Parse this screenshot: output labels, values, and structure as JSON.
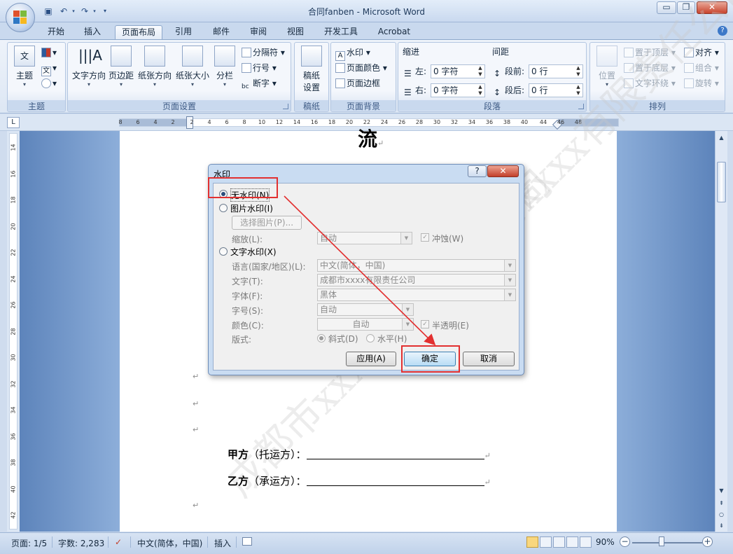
{
  "window": {
    "title": "合同fanben - Microsoft Word",
    "minimize": "▭",
    "restore": "❐",
    "close": "✕"
  },
  "quick_access": [
    "save-icon",
    "undo-icon",
    "redo-icon",
    "customize-icon"
  ],
  "tabs": [
    {
      "label": "开始"
    },
    {
      "label": "插入"
    },
    {
      "label": "页面布局",
      "active": true
    },
    {
      "label": "引用"
    },
    {
      "label": "邮件"
    },
    {
      "label": "审阅"
    },
    {
      "label": "视图"
    },
    {
      "label": "开发工具"
    },
    {
      "label": "Acrobat"
    }
  ],
  "ribbon": {
    "theme_group": {
      "label": "主题",
      "button": "主题"
    },
    "page_setup": {
      "label": "页面设置",
      "text_direction": "文字方向",
      "margins": "页边距",
      "orientation": "纸张方向",
      "size": "纸张大小",
      "columns": "分栏",
      "breaks": "分隔符",
      "line_numbers": "行号",
      "hyphenation": "断字"
    },
    "draft": {
      "label": "稿纸",
      "button_line1": "稿纸",
      "button_line2": "设置"
    },
    "page_background": {
      "label": "页面背景",
      "watermark": "水印",
      "page_color": "页面颜色",
      "page_borders": "页面边框"
    },
    "paragraph": {
      "label": "段落",
      "indent_title": "缩进",
      "spacing_title": "间距",
      "left_label": "左:",
      "left_value": "0 字符",
      "right_label": "右:",
      "right_value": "0 字符",
      "before_label": "段前:",
      "before_value": "0 行",
      "after_label": "段后:",
      "after_value": "0 行"
    },
    "arrange": {
      "label": "排列",
      "position": "位置",
      "bring_front": "置于顶层",
      "send_back": "置于底层",
      "text_wrap": "文字环绕",
      "align": "对齐",
      "group": "组合",
      "rotate": "旋转"
    }
  },
  "ruler": {
    "ticks": [
      "8",
      "6",
      "4",
      "2",
      "2",
      "4",
      "6",
      "8",
      "10",
      "12",
      "14",
      "16",
      "18",
      "20",
      "22",
      "24",
      "26",
      "28",
      "30",
      "32",
      "34",
      "36",
      "38",
      "40",
      "44",
      "46",
      "48"
    ],
    "vticks": [
      "14",
      "16",
      "18",
      "20",
      "22",
      "24",
      "26",
      "28",
      "30",
      "32",
      "34",
      "36",
      "38",
      "40",
      "42"
    ]
  },
  "document": {
    "heading_fragment": "流",
    "party_a_bold": "甲方",
    "party_a_rest": "（托运方）：",
    "party_b_bold": "乙方",
    "party_b_rest": "（承运方）：",
    "watermark_text": "成都市xxxx有限责任公司"
  },
  "dialog": {
    "title": "水印",
    "help": "?",
    "close": "✕",
    "no_watermark": "无水印(N)",
    "picture_watermark": "图片水印(I)",
    "select_picture": "选择图片(P)...",
    "scale_label": "缩放(L):",
    "scale_value": "自动",
    "washout": "冲蚀(W)",
    "text_watermark": "文字水印(X)",
    "language_label": "语言(国家/地区)(L):",
    "language_value": "中文(简体，中国)",
    "text_label": "文字(T):",
    "text_value": "成都市xxxx有限责任公司",
    "font_label": "字体(F):",
    "font_value": "黑体",
    "size_label": "字号(S):",
    "size_value": "自动",
    "color_label": "颜色(C):",
    "color_value": "自动",
    "semitransparent": "半透明(E)",
    "layout_label": "版式:",
    "diagonal": "斜式(D)",
    "horizontal": "水平(H)",
    "apply": "应用(A)",
    "ok": "确定",
    "cancel": "取消"
  },
  "statusbar": {
    "page": "页面: 1/5",
    "words": "字数: 2,283",
    "language": "中文(简体，中国)",
    "mode": "插入",
    "zoom": "90%"
  },
  "colors": {
    "highlight_red": "#e23030",
    "ribbon_blue": "#c9d9ee"
  }
}
